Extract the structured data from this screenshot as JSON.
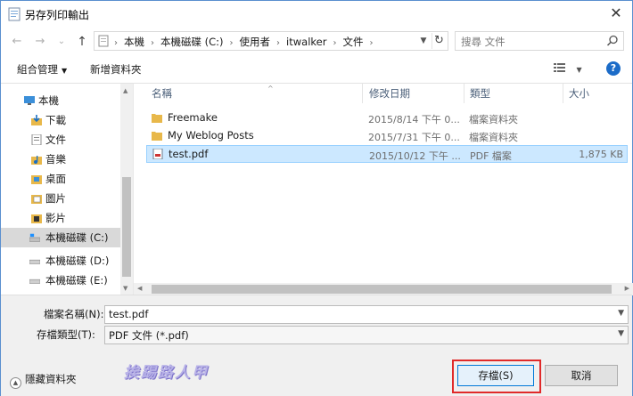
{
  "window": {
    "title": "另存列印輸出",
    "close_glyph": "✕"
  },
  "nav": {
    "back_glyph": "←",
    "forward_glyph": "→",
    "recent_glyph": "⌄",
    "up_glyph": "↑",
    "breadcrumbs": [
      "本機",
      "本機磁碟 (C:)",
      "使用者",
      "itwalker",
      "文件"
    ],
    "search_placeholder": "搜尋 文件",
    "refresh_glyph": "↻"
  },
  "toolbar": {
    "organize_label": "組合管理",
    "new_folder_label": "新增資料夾",
    "help_label": "?"
  },
  "sidebar": {
    "items": [
      {
        "label": "本機",
        "icon": "pc-icon"
      },
      {
        "label": "下載",
        "icon": "downloads-icon"
      },
      {
        "label": "文件",
        "icon": "documents-icon"
      },
      {
        "label": "音樂",
        "icon": "music-icon"
      },
      {
        "label": "桌面",
        "icon": "desktop-icon"
      },
      {
        "label": "圖片",
        "icon": "pictures-icon"
      },
      {
        "label": "影片",
        "icon": "videos-icon"
      },
      {
        "label": "本機磁碟 (C:)",
        "icon": "drive-c-icon",
        "selected": true
      },
      {
        "label": "本機磁碟 (D:)",
        "icon": "drive-icon"
      },
      {
        "label": "本機磁碟 (E:)",
        "icon": "drive-icon"
      }
    ]
  },
  "files": {
    "columns": [
      "名稱",
      "修改日期",
      "類型",
      "大小"
    ],
    "rows": [
      {
        "name": "Freemake",
        "date": "2015/8/14 下午 0...",
        "type": "檔案資料夾",
        "size": "",
        "icon": "folder-icon"
      },
      {
        "name": "My Weblog Posts",
        "date": "2015/7/31 下午 0...",
        "type": "檔案資料夾",
        "size": "",
        "icon": "folder-icon"
      },
      {
        "name": "test.pdf",
        "date": "2015/10/12 下午 ...",
        "type": "PDF 檔案",
        "size": "1,875 KB",
        "icon": "pdf-file-icon",
        "selected": true
      }
    ]
  },
  "form": {
    "filename_label": "檔案名稱(N):",
    "filename_value": "test.pdf",
    "filetype_label": "存檔類型(T):",
    "filetype_value": "PDF 文件 (*.pdf)",
    "hide_folders_label": "隱藏資料夾",
    "save_label": "存檔(S)",
    "cancel_label": "取消",
    "watermark": "挨踢路人甲"
  },
  "colors": {
    "accent": "#0078d7",
    "selection": "#cce8ff",
    "highlight": "#e02a2a",
    "folder": "#e8b84a"
  }
}
